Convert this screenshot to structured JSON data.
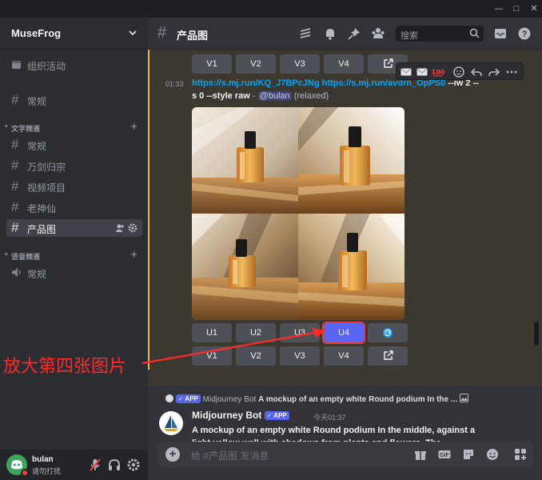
{
  "window": {
    "controls": [
      "—",
      "□",
      "✕"
    ]
  },
  "server": {
    "name": "MuseFrog"
  },
  "sidebar": {
    "event_label": "组织活动",
    "top_channel": "常规",
    "text_category": "文字频道",
    "text_channels": [
      "常规",
      "万剑归宗",
      "视频项目",
      "老神仙",
      "产品图"
    ],
    "voice_category": "语音频道",
    "voice_channels": [
      "常规"
    ]
  },
  "user": {
    "name": "bulan",
    "status": "请勿打扰"
  },
  "channel": {
    "title": "产品图"
  },
  "search": {
    "placeholder": "搜索"
  },
  "upper_buttons": [
    "V1",
    "V2",
    "V3",
    "V4"
  ],
  "message": {
    "time": "01:33",
    "link1": "https://s.mj.run/KQ_J7BPcJNg",
    "link2": "https://s.mj.run/avdrn_OpPS0",
    "params1": " --iw 2 --",
    "params2": "s 0 --style raw",
    "dash": " - ",
    "mention": "@bulan",
    "mode": " (relaxed)"
  },
  "upscale_buttons": [
    "U1",
    "U2",
    "U3",
    "U4"
  ],
  "variation_buttons": [
    "V1",
    "V2",
    "V3",
    "V4"
  ],
  "annotation": "放大第四张图片",
  "reply": {
    "tag": "✓ APP",
    "author": "Midjourney Bot",
    "snippet": "A mockup of an empty white Round podium In the ..."
  },
  "bot_message": {
    "author": "Midjourney Bot",
    "tag": "✓ APP",
    "time": "今天01:37",
    "text": "A mockup of an empty white Round podium In the middle, against a light yellow wall with shadows from plants and flowers. The background is a natural scene with small"
  },
  "composer": {
    "placeholder": "给 #产品图 发消息"
  },
  "colors": {
    "blurple": "#5865f2",
    "highlight": "#f0b232",
    "annotation": "#ff2a2a"
  }
}
